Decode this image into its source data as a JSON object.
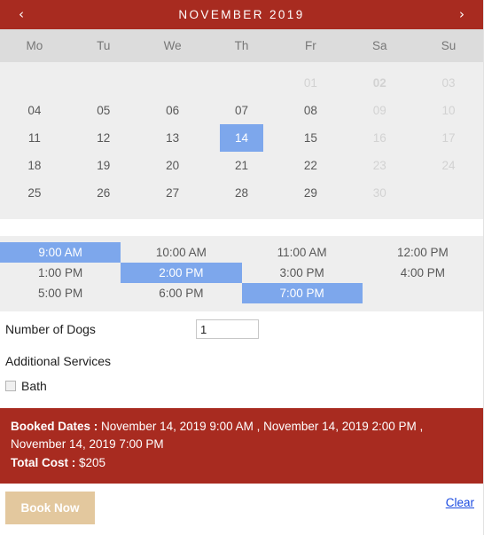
{
  "calendar": {
    "prev_icon": "chevron-left-icon",
    "next_icon": "chevron-right-icon",
    "title": "NOVEMBER 2019",
    "weekdays": [
      "Mo",
      "Tu",
      "We",
      "Th",
      "Fr",
      "Sa",
      "Su"
    ],
    "weeks": [
      [
        {
          "label": "",
          "state": "empty"
        },
        {
          "label": "",
          "state": "empty"
        },
        {
          "label": "",
          "state": "empty"
        },
        {
          "label": "",
          "state": "empty"
        },
        {
          "label": "01",
          "state": "disabled"
        },
        {
          "label": "02",
          "state": "disabled-bold"
        },
        {
          "label": "03",
          "state": "disabled"
        }
      ],
      [
        {
          "label": "04",
          "state": "enabled"
        },
        {
          "label": "05",
          "state": "enabled"
        },
        {
          "label": "06",
          "state": "enabled"
        },
        {
          "label": "07",
          "state": "enabled"
        },
        {
          "label": "08",
          "state": "enabled"
        },
        {
          "label": "09",
          "state": "disabled"
        },
        {
          "label": "10",
          "state": "disabled"
        }
      ],
      [
        {
          "label": "11",
          "state": "enabled"
        },
        {
          "label": "12",
          "state": "enabled"
        },
        {
          "label": "13",
          "state": "enabled"
        },
        {
          "label": "14",
          "state": "selected"
        },
        {
          "label": "15",
          "state": "enabled"
        },
        {
          "label": "16",
          "state": "disabled"
        },
        {
          "label": "17",
          "state": "disabled"
        }
      ],
      [
        {
          "label": "18",
          "state": "enabled"
        },
        {
          "label": "19",
          "state": "enabled"
        },
        {
          "label": "20",
          "state": "enabled"
        },
        {
          "label": "21",
          "state": "enabled"
        },
        {
          "label": "22",
          "state": "enabled"
        },
        {
          "label": "23",
          "state": "disabled"
        },
        {
          "label": "24",
          "state": "disabled"
        }
      ],
      [
        {
          "label": "25",
          "state": "enabled"
        },
        {
          "label": "26",
          "state": "enabled"
        },
        {
          "label": "27",
          "state": "enabled"
        },
        {
          "label": "28",
          "state": "enabled"
        },
        {
          "label": "29",
          "state": "enabled"
        },
        {
          "label": "30",
          "state": "disabled"
        },
        {
          "label": "",
          "state": "empty"
        }
      ]
    ]
  },
  "timeslots": {
    "rows": [
      [
        {
          "label": "9:00 AM",
          "state": "selected"
        },
        {
          "label": "10:00 AM",
          "state": "enabled"
        },
        {
          "label": "11:00 AM",
          "state": "enabled"
        },
        {
          "label": "12:00 PM",
          "state": "enabled"
        }
      ],
      [
        {
          "label": "1:00 PM",
          "state": "enabled"
        },
        {
          "label": "2:00 PM",
          "state": "selected"
        },
        {
          "label": "3:00 PM",
          "state": "enabled"
        },
        {
          "label": "4:00 PM",
          "state": "enabled"
        }
      ],
      [
        {
          "label": "5:00 PM",
          "state": "enabled"
        },
        {
          "label": "6:00 PM",
          "state": "enabled"
        },
        {
          "label": "7:00 PM",
          "state": "selected"
        },
        {
          "label": "",
          "state": "empty"
        }
      ]
    ]
  },
  "form": {
    "dogs_label": "Number of Dogs",
    "dogs_value": "1",
    "services_label": "Additional Services",
    "bath_label": "Bath",
    "bath_checked": false
  },
  "summary": {
    "booked_dates_label": "Booked Dates :",
    "booked_dates_value": "November 14, 2019 9:00 AM , November 14, 2019 2:00 PM , November 14, 2019 7:00 PM",
    "total_cost_label": "Total Cost :",
    "total_cost_value": "$205"
  },
  "footer": {
    "book_label": "Book Now",
    "clear_label": "Clear"
  },
  "colors": {
    "brand_red": "#a82b20",
    "selected_blue": "#7da7ec",
    "button_tan": "#e3c89e",
    "link_blue": "#1a4ae0",
    "panel_gray": "#eeeeee",
    "weekday_gray": "#dcdcdc"
  }
}
